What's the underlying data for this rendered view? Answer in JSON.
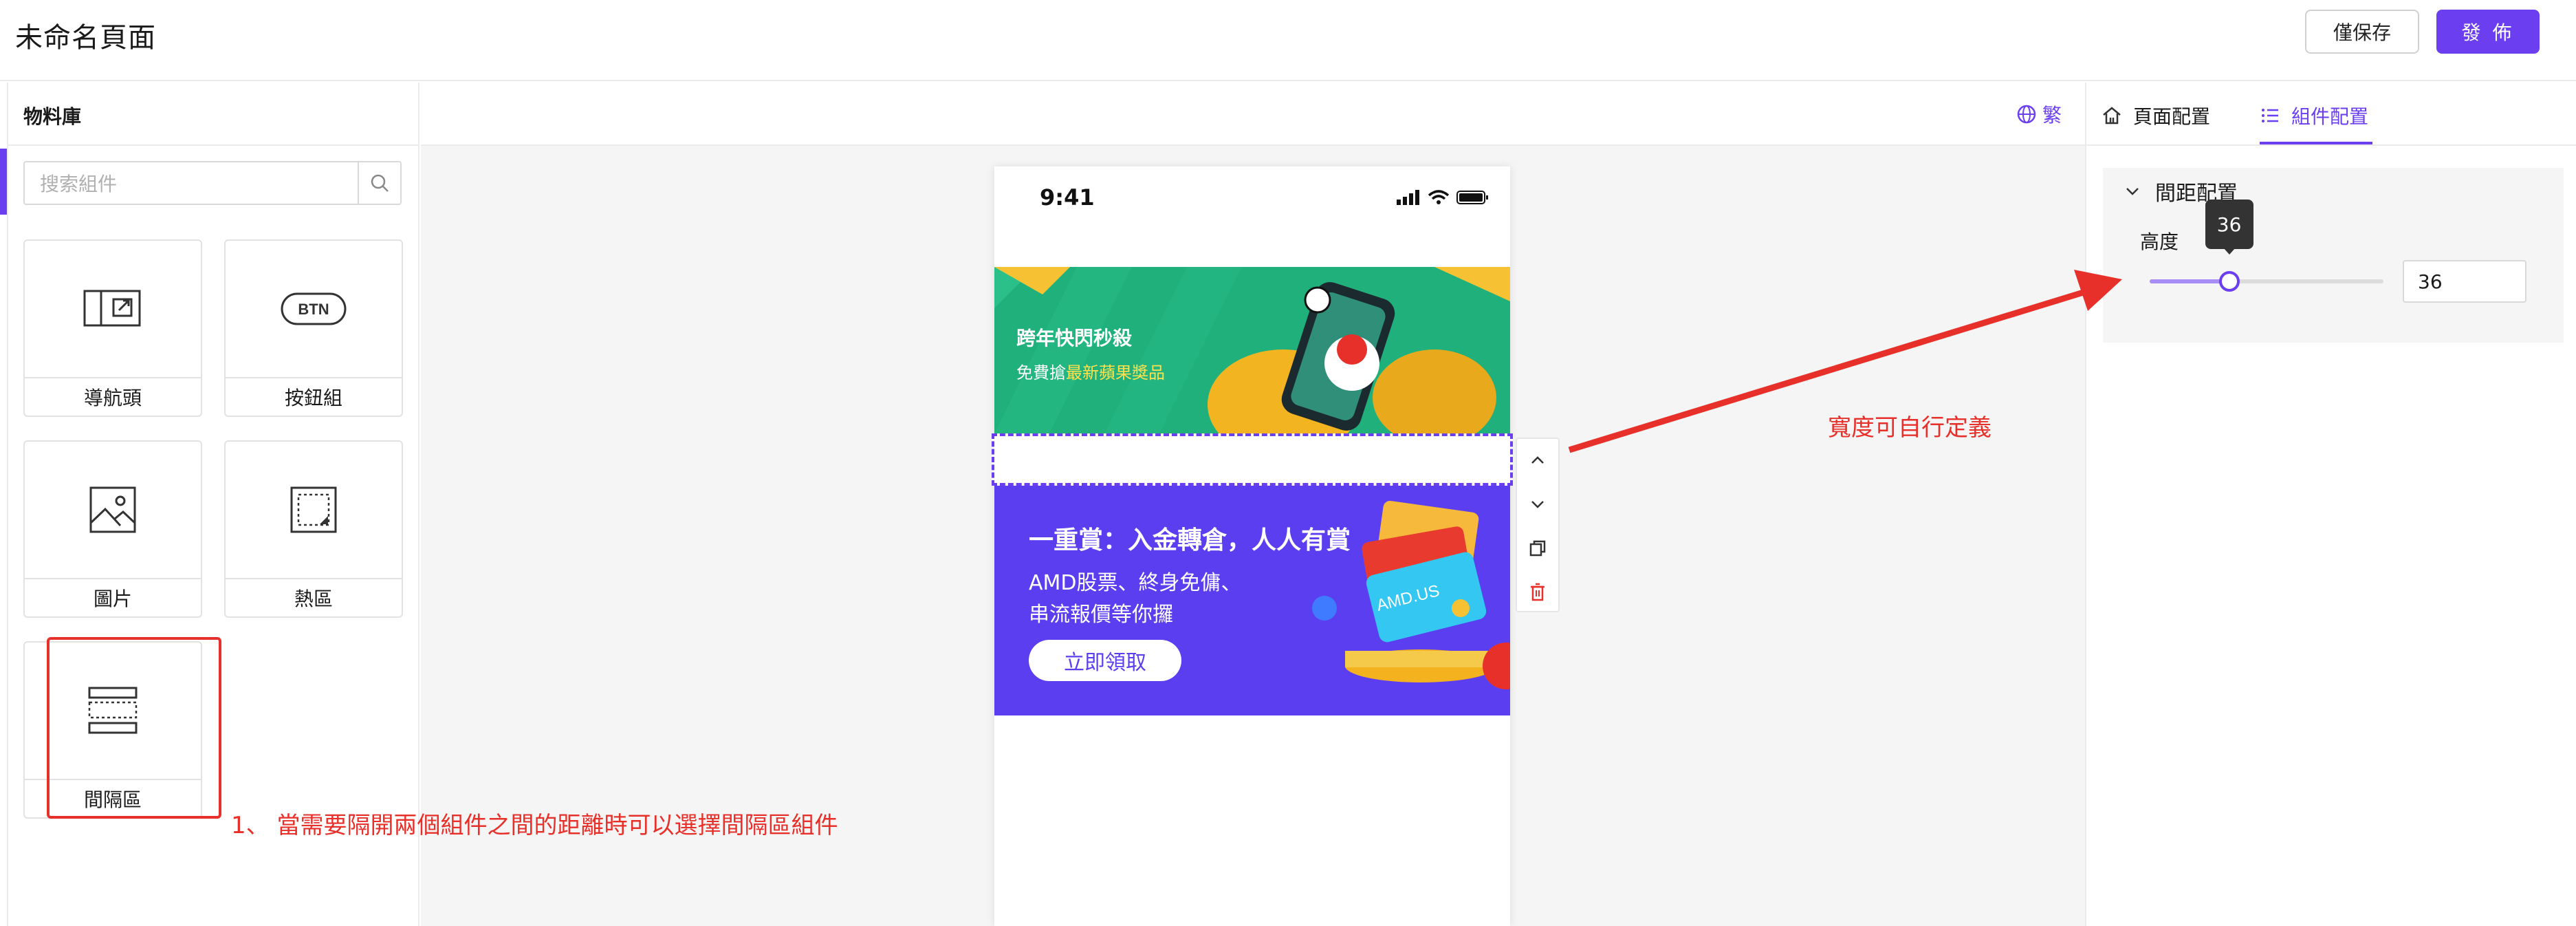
{
  "header": {
    "page_title": "未命名頁面",
    "save_label": "僅保存",
    "publish_label": "發 佈"
  },
  "left_panel": {
    "title": "物料庫",
    "search_placeholder": "搜索組件",
    "components": [
      {
        "label": "導航頭",
        "icon": "navbar-icon"
      },
      {
        "label": "按鈕組",
        "icon": "button-group-icon"
      },
      {
        "label": "圖片",
        "icon": "image-icon"
      },
      {
        "label": "熱區",
        "icon": "hotspot-icon"
      },
      {
        "label": "間隔區",
        "icon": "spacer-icon"
      }
    ]
  },
  "canvas": {
    "language_toggle": "繁",
    "phone_status_time": "9:41",
    "banner1": {
      "title": "跨年快閃秒殺",
      "subtitle_prefix": "免費搶",
      "subtitle_highlight": "最新蘋果獎品"
    },
    "banner2": {
      "title": "一重賞：入金轉倉，人人有賞",
      "line1": "AMD股票、終身免傭、",
      "line2": "串流報價等你攞",
      "cta": "立即領取",
      "card_text": "AMD.US"
    }
  },
  "right_panel": {
    "tabs": [
      {
        "label": "頁面配置",
        "icon": "home-icon",
        "active": false
      },
      {
        "label": "組件配置",
        "icon": "list-icon",
        "active": true
      }
    ],
    "section_title": "間距配置",
    "height_label": "高度",
    "height_value": "36",
    "slider_tooltip": "36",
    "slider_fraction": 0.34
  },
  "annotations": {
    "left_note": "1、 當需要隔開兩個組件之間的距離時可以選擇間隔區組件",
    "right_note": "寬度可自行定義"
  },
  "colors": {
    "accent": "#6b3ef0",
    "annotation": "#e8302a",
    "banner1_bg": "#1fb07b",
    "banner2_bg": "#5a3ef0"
  }
}
